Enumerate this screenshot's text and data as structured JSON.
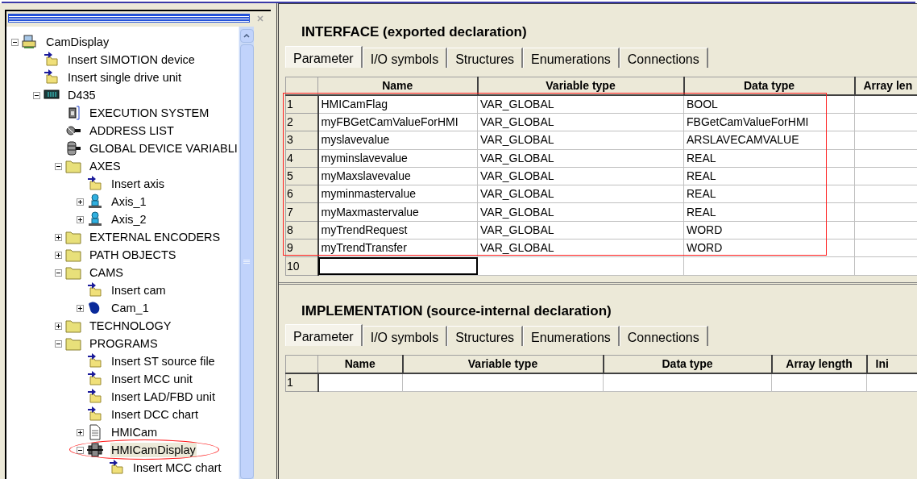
{
  "tree": [
    {
      "label": "CamDisplay",
      "kind": "project",
      "expanded": true,
      "selected": false,
      "children": [
        {
          "label": "Insert SIMOTION device",
          "kind": "insert",
          "selected": false
        },
        {
          "label": "Insert single drive unit",
          "kind": "insert",
          "selected": false
        },
        {
          "label": "D435",
          "kind": "device",
          "expanded": true,
          "selected": false,
          "children": [
            {
              "label": "EXECUTION SYSTEM",
              "kind": "execution",
              "selected": false
            },
            {
              "label": "ADDRESS LIST",
              "kind": "address",
              "selected": false
            },
            {
              "label": "GLOBAL DEVICE VARIABLI",
              "kind": "database",
              "selected": false
            },
            {
              "label": "AXES",
              "kind": "folder",
              "expanded": true,
              "selected": false,
              "children": [
                {
                  "label": "Insert axis",
                  "kind": "insert",
                  "selected": false
                },
                {
                  "label": "Axis_1",
                  "kind": "axis",
                  "expanded": false,
                  "selected": false
                },
                {
                  "label": "Axis_2",
                  "kind": "axis",
                  "expanded": false,
                  "selected": false
                }
              ]
            },
            {
              "label": "EXTERNAL ENCODERS",
              "kind": "folder",
              "expanded": false,
              "selected": false
            },
            {
              "label": "PATH OBJECTS",
              "kind": "folder",
              "expanded": false,
              "selected": false
            },
            {
              "label": "CAMS",
              "kind": "folder",
              "expanded": true,
              "selected": false,
              "children": [
                {
                  "label": "Insert cam",
                  "kind": "insert",
                  "selected": false
                },
                {
                  "label": "Cam_1",
                  "kind": "cam",
                  "expanded": false,
                  "selected": false
                }
              ]
            },
            {
              "label": "TECHNOLOGY",
              "kind": "folder",
              "expanded": false,
              "selected": false
            },
            {
              "label": "PROGRAMS",
              "kind": "folder",
              "expanded": true,
              "selected": false,
              "children": [
                {
                  "label": "Insert ST source file",
                  "kind": "insert",
                  "selected": false
                },
                {
                  "label": "Insert MCC unit",
                  "kind": "insert",
                  "selected": false
                },
                {
                  "label": "Insert LAD/FBD unit",
                  "kind": "insert",
                  "selected": false
                },
                {
                  "label": "Insert DCC chart",
                  "kind": "insert",
                  "selected": false
                },
                {
                  "label": "HMICam",
                  "kind": "source",
                  "expanded": false,
                  "selected": false
                },
                {
                  "label": "HMICamDisplay",
                  "kind": "program",
                  "expanded": true,
                  "selected": true,
                  "children": [
                    {
                      "label": "Insert MCC chart",
                      "kind": "insert",
                      "selected": false
                    }
                  ]
                }
              ]
            }
          ]
        }
      ]
    }
  ],
  "panels": [
    {
      "title": "INTERFACE (exported declaration)",
      "tabs": [
        {
          "label": "Parameter",
          "selected": true
        },
        {
          "label": "I/O symbols",
          "selected": false
        },
        {
          "label": "Structures",
          "selected": false
        },
        {
          "label": "Enumerations",
          "selected": false
        },
        {
          "label": "Connections",
          "selected": false
        }
      ],
      "columns": [
        "Name",
        "Variable type",
        "Data type",
        "Array len"
      ],
      "rows": [
        {
          "number": "1",
          "cells": [
            "HMICamFlag",
            "VAR_GLOBAL",
            "BOOL"
          ],
          "focused": false
        },
        {
          "number": "2",
          "cells": [
            "myFBGetCamValueForHMI",
            "VAR_GLOBAL",
            "FBGetCamValueForHMI"
          ],
          "focused": false
        },
        {
          "number": "3",
          "cells": [
            "myslavevalue",
            "VAR_GLOBAL",
            "ARSLAVECAMVALUE"
          ],
          "focused": false
        },
        {
          "number": "4",
          "cells": [
            "myminslavevalue",
            "VAR_GLOBAL",
            "REAL"
          ],
          "focused": false
        },
        {
          "number": "5",
          "cells": [
            "myMaxslavevalue",
            "VAR_GLOBAL",
            "REAL"
          ],
          "focused": false
        },
        {
          "number": "6",
          "cells": [
            "myminmastervalue",
            "VAR_GLOBAL",
            "REAL"
          ],
          "focused": false
        },
        {
          "number": "7",
          "cells": [
            "myMaxmastervalue",
            "VAR_GLOBAL",
            "REAL"
          ],
          "focused": false
        },
        {
          "number": "8",
          "cells": [
            "myTrendRequest",
            "VAR_GLOBAL",
            "WORD"
          ],
          "focused": false
        },
        {
          "number": "9",
          "cells": [
            "myTrendTransfer",
            "VAR_GLOBAL",
            "WORD"
          ],
          "focused": false
        },
        {
          "number": "10",
          "cells": [],
          "focused": true
        }
      ]
    },
    {
      "title": "IMPLEMENTATION (source-internal declaration)",
      "tabs": [
        {
          "label": "Parameter",
          "selected": true
        },
        {
          "label": "I/O symbols",
          "selected": false
        },
        {
          "label": "Structures",
          "selected": false
        },
        {
          "label": "Enumerations",
          "selected": false
        },
        {
          "label": "Connections",
          "selected": false
        }
      ],
      "columns": [
        "Name",
        "Variable type",
        "Data type",
        "Array length",
        "Ini"
      ],
      "rows": [
        {
          "number": "1",
          "cells": [],
          "focused": false
        }
      ]
    }
  ]
}
